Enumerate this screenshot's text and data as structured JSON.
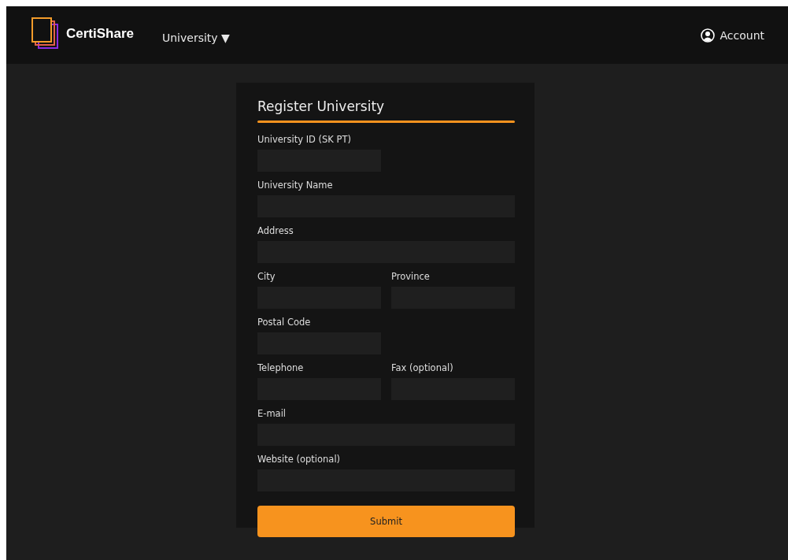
{
  "header": {
    "brand": "CertiShare",
    "menu": {
      "label": "University",
      "caret": "▼"
    },
    "account": "Account"
  },
  "form": {
    "title": "Register University",
    "rows": [
      [
        {
          "label": "University ID (SK PT)",
          "kind": "short"
        }
      ],
      [
        {
          "label": "University Name",
          "kind": "wide"
        }
      ],
      [
        {
          "label": "Address",
          "kind": "wide"
        }
      ],
      [
        {
          "label": "City",
          "kind": "short"
        },
        {
          "label": "Province",
          "kind": "short"
        }
      ],
      [
        {
          "label": "Postal Code",
          "kind": "short"
        }
      ],
      [
        {
          "label": "Telephone",
          "kind": "short"
        },
        {
          "label": "Fax (optional)",
          "kind": "short"
        }
      ],
      [
        {
          "label": "E-mail",
          "kind": "wide"
        }
      ],
      [
        {
          "label": "Website (optional)",
          "kind": "wide"
        }
      ]
    ],
    "submit": "Submit"
  }
}
